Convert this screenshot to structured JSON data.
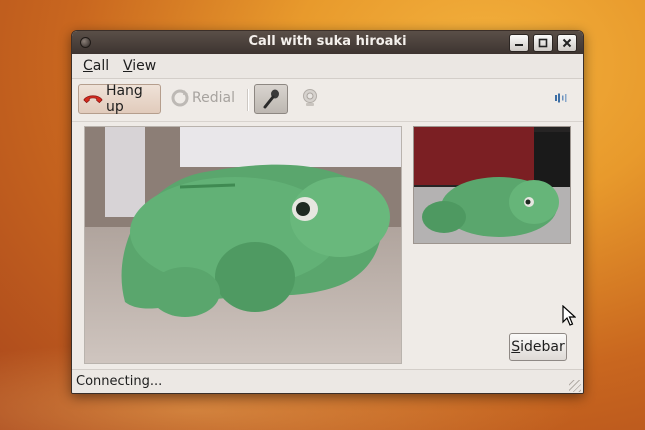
{
  "window": {
    "title": "Call with suka hiroaki"
  },
  "menu": {
    "items": [
      {
        "label_ul": "C",
        "label_rest": "all"
      },
      {
        "label_ul": "V",
        "label_rest": "iew"
      }
    ]
  },
  "toolbar": {
    "hangup_label": "Hang up",
    "redial_label": "Redial"
  },
  "sidebar_button": {
    "label_ul": "S",
    "label_rest": "idebar"
  },
  "status": {
    "text": "Connecting..."
  },
  "colors": {
    "hangup": "#d42a1e",
    "titlebar": "#3d3430",
    "window_bg": "#efebe7"
  },
  "icons": {
    "hangup": "phone-hangup-icon",
    "redial": "redial-icon",
    "mic": "microphone-icon",
    "camera": "webcam-icon",
    "volume": "volume-icon"
  }
}
